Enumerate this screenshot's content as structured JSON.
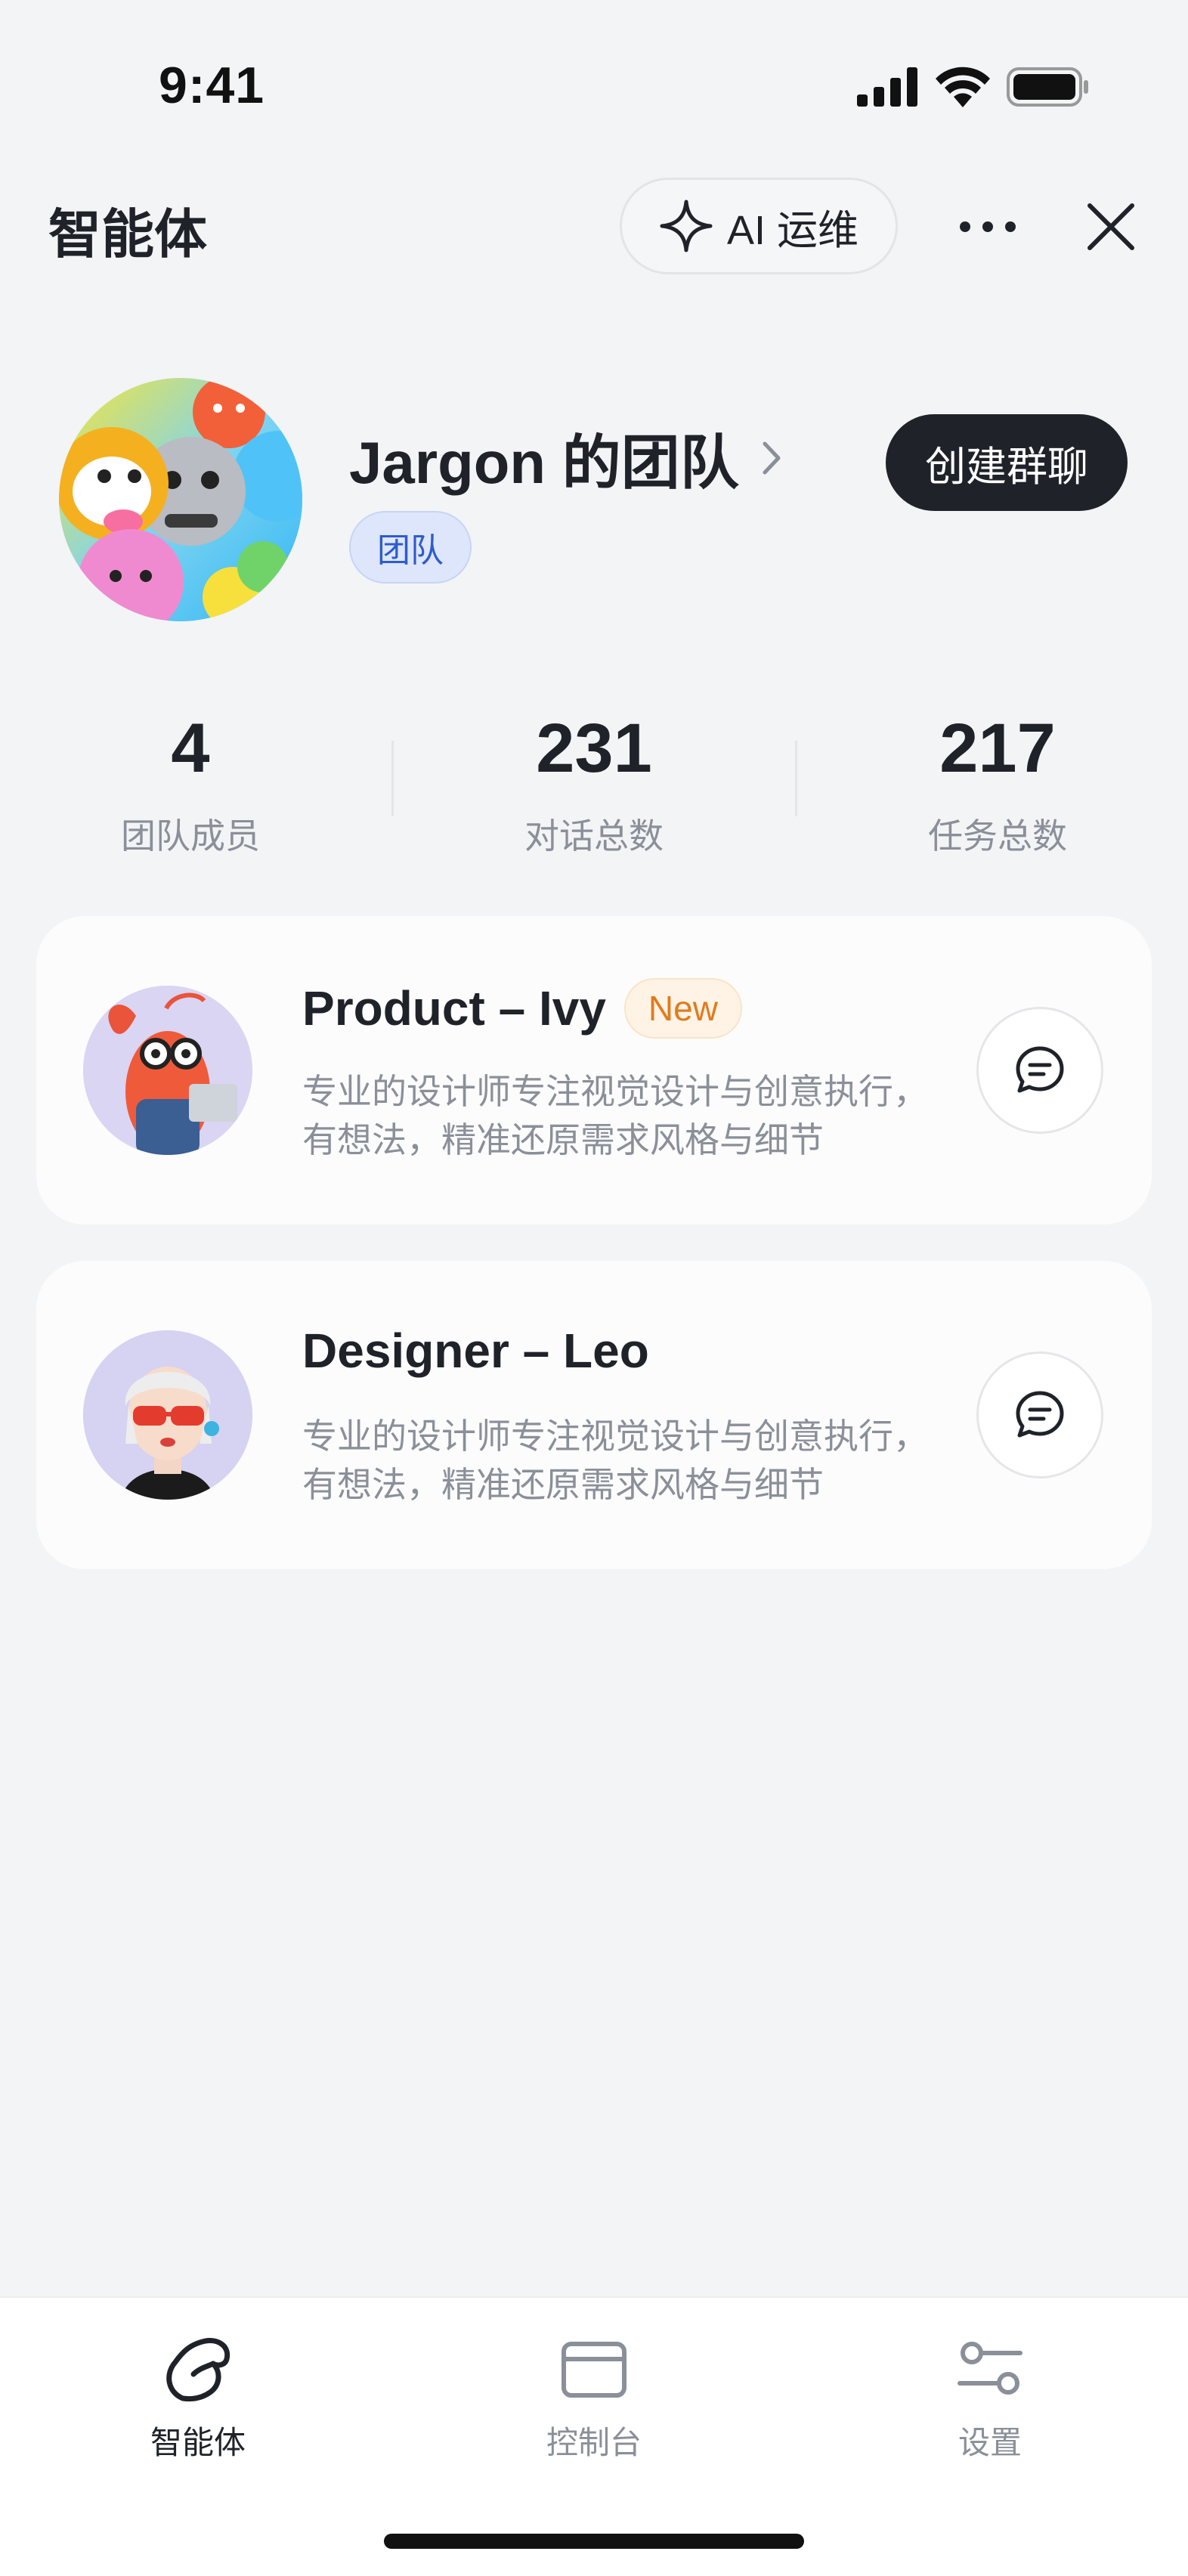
{
  "status_bar": {
    "time": "9:41"
  },
  "header": {
    "title": "智能体",
    "ai_button_label": "AI 运维"
  },
  "team": {
    "name": "Jargon 的团队",
    "badge": "团队",
    "create_button": "创建群聊"
  },
  "stats": [
    {
      "value": "4",
      "label": "团队成员"
    },
    {
      "value": "231",
      "label": "对话总数"
    },
    {
      "value": "217",
      "label": "任务总数"
    }
  ],
  "agents": [
    {
      "name": "Product – Ivy",
      "badge": "New",
      "description": "专业的设计师专注视觉设计与创意执行，有想法，精准还原需求风格与细节"
    },
    {
      "name": "Designer – Leo",
      "description": "专业的设计师专注视觉设计与创意执行，有想法，精准还原需求风格与细节"
    }
  ],
  "tab_bar": {
    "items": [
      {
        "label": "智能体",
        "icon": "agent-icon",
        "active": true
      },
      {
        "label": "控制台",
        "icon": "console-icon",
        "active": false
      },
      {
        "label": "设置",
        "icon": "settings-icon",
        "active": false
      }
    ]
  },
  "colors": {
    "background": "#F3F4F6",
    "primary_dark": "#1F2329",
    "badge_blue": "#2F5CCB",
    "badge_orange": "#E07B1D",
    "muted_text": "#8A8F99"
  }
}
